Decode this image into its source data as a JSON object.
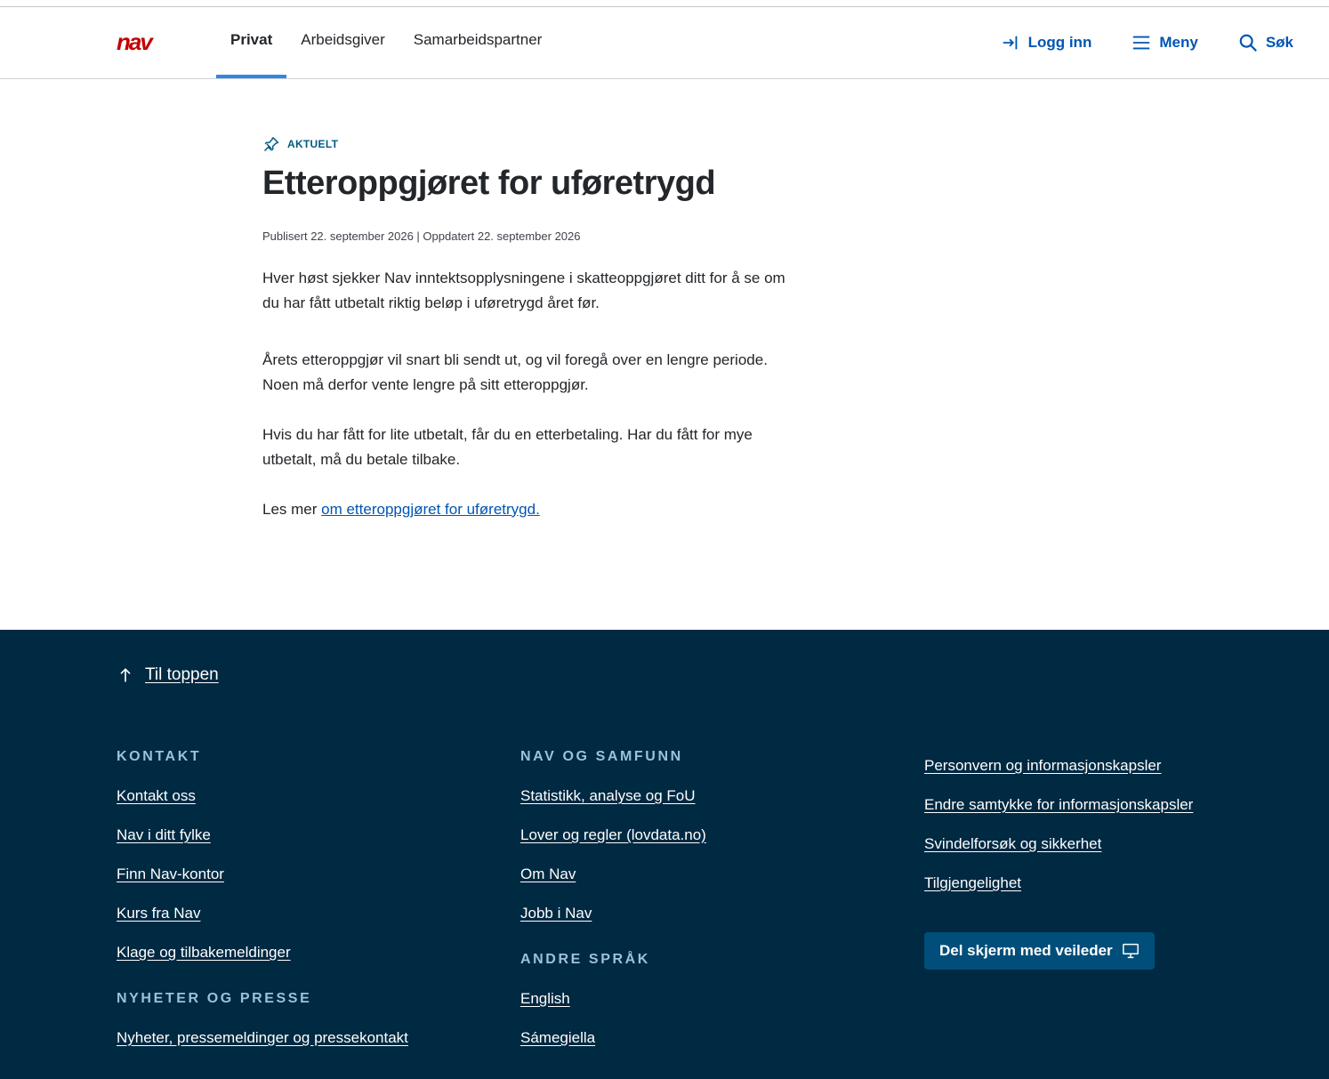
{
  "header": {
    "tabs": [
      {
        "label": "Privat",
        "active": true
      },
      {
        "label": "Arbeidsgiver",
        "active": false
      },
      {
        "label": "Samarbeidspartner",
        "active": false
      }
    ],
    "login_label": "Logg inn",
    "menu_label": "Meny",
    "search_label": "Søk",
    "logo_text": "nav"
  },
  "article": {
    "tag": "AKTUELT",
    "title": "Etteroppgjøret for uføretrygd",
    "meta": "Publisert 22. september 2026 | Oppdatert 22. september 2026",
    "p1": "Hver høst sjekker Nav inntektsopplysningene i skatteoppgjøret ditt for å se om du har fått utbetalt riktig beløp i uføretrygd året før.",
    "p2": "Årets etteroppgjør vil snart bli sendt ut, og vil foregå over en lengre periode. Noen må derfor vente lengre på sitt etteroppgjør.",
    "p3": "Hvis du har fått for lite utbetalt, får du en etterbetaling. Har du fått for mye utbetalt, må du betale tilbake.",
    "p4_prefix": "Les mer ",
    "p4_link": "om etteroppgjøret for uføretrygd."
  },
  "footer": {
    "to_top": "Til toppen",
    "kontakt": {
      "heading": "KONTAKT",
      "links": [
        "Kontakt oss",
        "Nav i ditt fylke",
        "Finn Nav-kontor",
        "Kurs fra Nav",
        "Klage og tilbakemeldinger"
      ]
    },
    "nyheter": {
      "heading": "NYHETER OG PRESSE",
      "links": [
        "Nyheter, pressemeldinger og pressekontakt"
      ]
    },
    "samfunn": {
      "heading": "NAV OG SAMFUNN",
      "links": [
        "Statistikk, analyse og FoU",
        "Lover og regler (lovdata.no)",
        "Om Nav",
        "Jobb i Nav"
      ]
    },
    "sprak": {
      "heading": "ANDRE SPRÅK",
      "links": [
        "English",
        "Sámegiella"
      ]
    },
    "personvern": {
      "links": [
        "Personvern og informasjonskapsler",
        "Endre samtykke for informasjonskapsler",
        "Svindelforsøk og sikkerhet",
        "Tilgjengelighet"
      ]
    },
    "share_button": "Del skjerm med veileder"
  },
  "colors": {
    "brand_red": "#c30000",
    "link_blue": "#0056b4",
    "active_tab": "#3386e0",
    "footer_bg": "#002942",
    "footer_heading": "#99c3d9",
    "share_button_bg": "#004e79"
  }
}
